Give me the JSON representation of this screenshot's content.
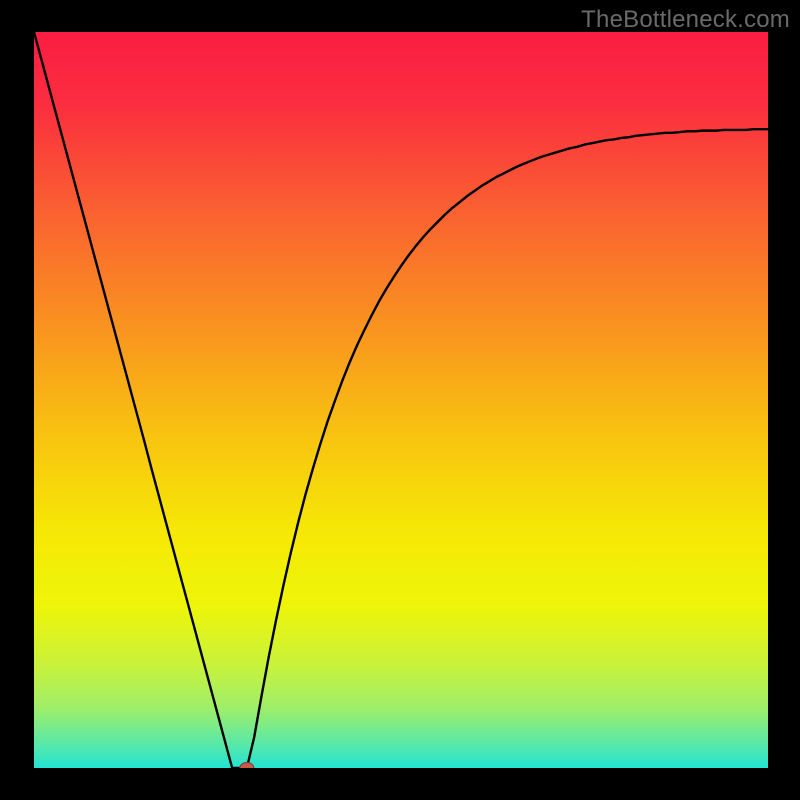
{
  "watermark": "TheBottleneck.com",
  "colors": {
    "gradient_stops": [
      {
        "offset": 0.0,
        "color": "#fb1d43"
      },
      {
        "offset": 0.1,
        "color": "#fb2e3f"
      },
      {
        "offset": 0.25,
        "color": "#fa6330"
      },
      {
        "offset": 0.4,
        "color": "#f9931f"
      },
      {
        "offset": 0.55,
        "color": "#f8c410"
      },
      {
        "offset": 0.68,
        "color": "#f6e805"
      },
      {
        "offset": 0.78,
        "color": "#eef509"
      },
      {
        "offset": 0.86,
        "color": "#c9f23a"
      },
      {
        "offset": 0.92,
        "color": "#9dee6b"
      },
      {
        "offset": 0.97,
        "color": "#55e8ab"
      },
      {
        "offset": 1.0,
        "color": "#22e3d4"
      }
    ],
    "curve": "#000000",
    "marker_fill": "#c85a4c",
    "marker_stroke": "#7e3a30",
    "frame": "#000000"
  },
  "chart_data": {
    "type": "line",
    "title": "",
    "xlabel": "",
    "ylabel": "",
    "xlim": [
      0,
      100
    ],
    "ylim": [
      0,
      100
    ],
    "x": [
      0,
      1,
      2,
      3,
      4,
      5,
      6,
      7,
      8,
      9,
      10,
      11,
      12,
      13,
      14,
      15,
      16,
      17,
      18,
      19,
      20,
      21,
      22,
      23,
      24,
      25,
      26,
      27,
      28,
      29,
      30,
      31,
      32,
      33,
      34,
      35,
      36,
      37,
      38,
      39,
      40,
      41,
      42,
      43,
      44,
      45,
      46,
      47,
      48,
      49,
      50,
      51,
      52,
      53,
      54,
      55,
      56,
      57,
      58,
      59,
      60,
      61,
      62,
      63,
      64,
      65,
      66,
      67,
      68,
      69,
      70,
      71,
      72,
      73,
      74,
      75,
      76,
      77,
      78,
      79,
      80,
      81,
      82,
      83,
      84,
      85,
      86,
      87,
      88,
      89,
      90,
      91,
      92,
      93,
      94,
      95,
      96,
      97,
      98,
      99,
      100
    ],
    "y": [
      100,
      96.3,
      92.6,
      88.9,
      85.2,
      81.5,
      77.8,
      74.1,
      70.4,
      66.7,
      63.0,
      59.3,
      55.6,
      51.9,
      48.2,
      44.5,
      40.7,
      37.0,
      33.3,
      29.6,
      25.9,
      22.2,
      18.5,
      14.8,
      11.1,
      7.4,
      3.7,
      0,
      0,
      0,
      4.2,
      9.8,
      15.2,
      20.2,
      24.9,
      29.3,
      33.4,
      37.2,
      40.7,
      44.0,
      47.1,
      49.9,
      52.6,
      55.1,
      57.4,
      59.5,
      61.5,
      63.4,
      65.1,
      66.7,
      68.2,
      69.6,
      70.9,
      72.1,
      73.2,
      74.2,
      75.2,
      76.1,
      76.9,
      77.7,
      78.4,
      79.1,
      79.7,
      80.3,
      80.8,
      81.3,
      81.8,
      82.2,
      82.6,
      83.0,
      83.3,
      83.6,
      83.9,
      84.2,
      84.4,
      84.7,
      84.9,
      85.1,
      85.3,
      85.4,
      85.6,
      85.7,
      85.9,
      86.0,
      86.1,
      86.2,
      86.3,
      86.3,
      86.4,
      86.5,
      86.5,
      86.6,
      86.6,
      86.6,
      86.7,
      86.7,
      86.7,
      86.7,
      86.8,
      86.8,
      86.8
    ],
    "marker": {
      "x": 29,
      "y": 0
    }
  }
}
